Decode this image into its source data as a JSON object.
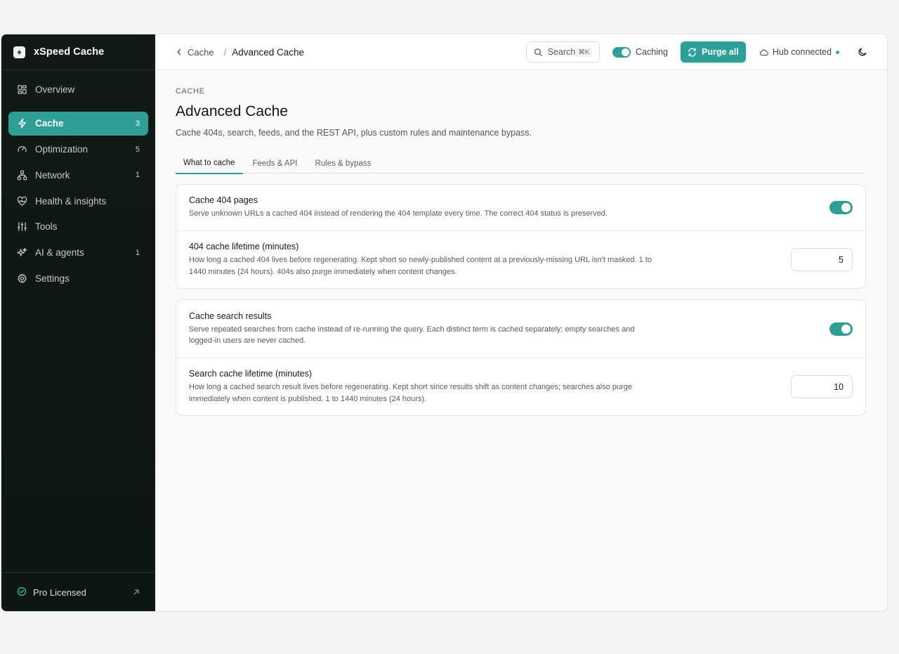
{
  "brand": {
    "name": "xSpeed Cache"
  },
  "sidebar": {
    "items": [
      {
        "label": "Overview",
        "count": ""
      },
      {
        "label": "Cache",
        "count": "3"
      },
      {
        "label": "Optimization",
        "count": "5"
      },
      {
        "label": "Network",
        "count": "1"
      },
      {
        "label": "Health & insights",
        "count": ""
      },
      {
        "label": "Tools",
        "count": ""
      },
      {
        "label": "AI & agents",
        "count": "1"
      },
      {
        "label": "Settings",
        "count": ""
      }
    ],
    "footer": {
      "label": "Pro Licensed"
    }
  },
  "topbar": {
    "breadcrumb_parent": "Cache",
    "breadcrumb_separator": "/",
    "breadcrumb_current": "Advanced Cache",
    "search_label": "Search",
    "search_shortcut": "⌘K",
    "caching_label": "Caching",
    "purge_label": "Purge all",
    "hub_label": "Hub connected"
  },
  "page": {
    "eyebrow": "CACHE",
    "title": "Advanced Cache",
    "description": "Cache 404s, search, feeds, and the REST API, plus custom rules and maintenance bypass."
  },
  "tabs": [
    {
      "label": "What to cache"
    },
    {
      "label": "Feeds & API"
    },
    {
      "label": "Rules & bypass"
    }
  ],
  "settings": {
    "cache404": {
      "title": "Cache 404 pages",
      "description": "Serve unknown URLs a cached 404 instead of rendering the 404 template every time. The correct 404 status is preserved."
    },
    "lifetime404": {
      "title": "404 cache lifetime (minutes)",
      "description": "How long a cached 404 lives before regenerating. Kept short so newly-published content at a previously-missing URL isn't masked. 1 to 1440 minutes (24 hours). 404s also purge immediately when content changes.",
      "value": "5"
    },
    "cacheSearch": {
      "title": "Cache search results",
      "description": "Serve repeated searches from cache instead of re-running the query. Each distinct term is cached separately; empty searches and logged-in users are never cached."
    },
    "lifetimeSearch": {
      "title": "Search cache lifetime (minutes)",
      "description": "How long a cached search result lives before regenerating. Kept short since results shift as content changes; searches also purge immediately when content is published. 1 to 1440 minutes (24 hours).",
      "value": "10"
    }
  },
  "colors": {
    "accent": "#2e9f96",
    "sidebar_bg": "#0f1816",
    "status_dot": "#22b39a"
  }
}
